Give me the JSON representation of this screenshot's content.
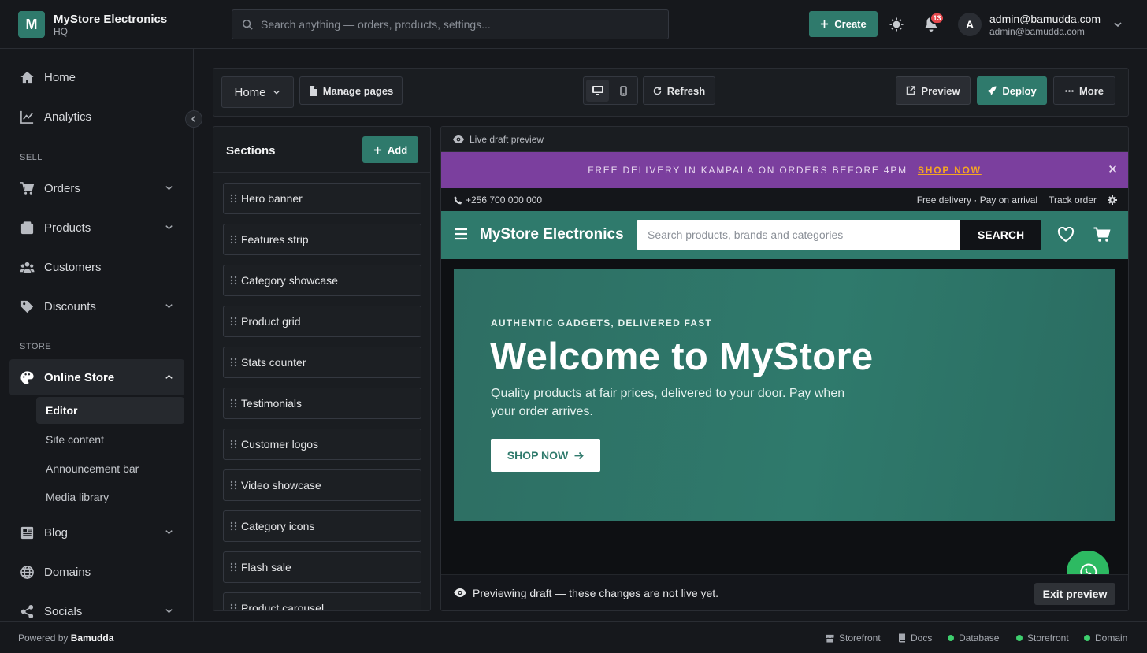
{
  "app": {
    "logo_letter": "M",
    "store_name": "MyStore Electronics",
    "store_sub": "HQ"
  },
  "topbar": {
    "search_placeholder": "Search anything — orders, products, settings...",
    "create_label": "Create",
    "notification_count": "13",
    "user_initial": "A",
    "user_name": "admin@bamudda.com",
    "user_email": "admin@bamudda.com"
  },
  "sidebar": {
    "home": "Home",
    "analytics": "Analytics",
    "sell_label": "SELL",
    "orders": "Orders",
    "products": "Products",
    "customers": "Customers",
    "discounts": "Discounts",
    "store_label": "STORE",
    "online_store": "Online Store",
    "sub_items": [
      "Editor",
      "Site content",
      "Announcement bar",
      "Media library"
    ],
    "blog": "Blog",
    "domains": "Domains",
    "socials": "Socials"
  },
  "toolbar": {
    "page_select": "Home",
    "manage_pages": "Manage pages",
    "refresh": "Refresh",
    "preview": "Preview",
    "deploy": "Deploy",
    "more": "More"
  },
  "sections_panel": {
    "title": "Sections",
    "add_label": "Add",
    "items": [
      "Hero banner",
      "Features strip",
      "Category showcase",
      "Product grid",
      "Stats counter",
      "Testimonials",
      "Customer logos",
      "Video showcase",
      "Category icons",
      "Flash sale",
      "Product carousel"
    ]
  },
  "preview": {
    "header_label": "Live draft preview",
    "announcement_text": "FREE DELIVERY IN KAMPALA ON ORDERS BEFORE 4PM",
    "announcement_link": "SHOP NOW",
    "phone": "+256 700 000 000",
    "utility_info": "Free delivery · Pay on arrival",
    "track_order": "Track order",
    "store_name": "MyStore Electronics",
    "search_placeholder": "Search products, brands and categories",
    "search_button": "SEARCH",
    "hero_tag": "AUTHENTIC GADGETS, DELIVERED FAST",
    "hero_title": "Welcome to MyStore",
    "hero_text": "Quality products at fair prices, delivered to your door. Pay when your order arrives.",
    "hero_button": "SHOP NOW",
    "draft_notice": "Previewing draft — these changes are not live yet.",
    "exit_preview": "Exit preview"
  },
  "footer": {
    "powered_prefix": "Powered by",
    "powered_brand": "Bamudda",
    "storefront_link": "Storefront",
    "docs_link": "Docs",
    "status_database": "Database",
    "status_storefront": "Storefront",
    "status_domain": "Domain"
  },
  "colors": {
    "brand": "#2f7a6c",
    "announcement_bg": "#7b3f9e",
    "announcement_link": "#f5a623",
    "badge": "#e5484d",
    "status_ok": "#3ecf6e",
    "whatsapp": "#2dba62"
  }
}
